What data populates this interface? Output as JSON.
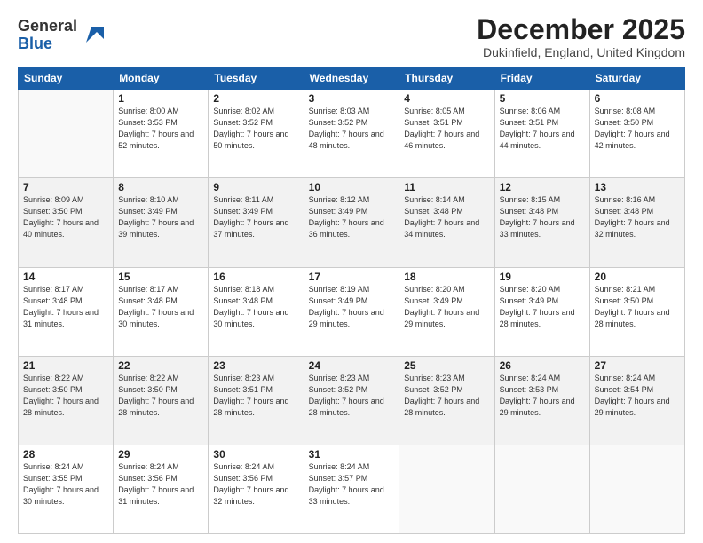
{
  "header": {
    "logo": {
      "line1": "General",
      "line2": "Blue"
    },
    "title": "December 2025",
    "subtitle": "Dukinfield, England, United Kingdom"
  },
  "weekdays": [
    "Sunday",
    "Monday",
    "Tuesday",
    "Wednesday",
    "Thursday",
    "Friday",
    "Saturday"
  ],
  "weeks": [
    [
      {
        "day": "",
        "sunrise": "",
        "sunset": "",
        "daylight": ""
      },
      {
        "day": "1",
        "sunrise": "8:00 AM",
        "sunset": "3:53 PM",
        "daylight": "7 hours and 52 minutes."
      },
      {
        "day": "2",
        "sunrise": "8:02 AM",
        "sunset": "3:52 PM",
        "daylight": "7 hours and 50 minutes."
      },
      {
        "day": "3",
        "sunrise": "8:03 AM",
        "sunset": "3:52 PM",
        "daylight": "7 hours and 48 minutes."
      },
      {
        "day": "4",
        "sunrise": "8:05 AM",
        "sunset": "3:51 PM",
        "daylight": "7 hours and 46 minutes."
      },
      {
        "day": "5",
        "sunrise": "8:06 AM",
        "sunset": "3:51 PM",
        "daylight": "7 hours and 44 minutes."
      },
      {
        "day": "6",
        "sunrise": "8:08 AM",
        "sunset": "3:50 PM",
        "daylight": "7 hours and 42 minutes."
      }
    ],
    [
      {
        "day": "7",
        "sunrise": "8:09 AM",
        "sunset": "3:50 PM",
        "daylight": "7 hours and 40 minutes."
      },
      {
        "day": "8",
        "sunrise": "8:10 AM",
        "sunset": "3:49 PM",
        "daylight": "7 hours and 39 minutes."
      },
      {
        "day": "9",
        "sunrise": "8:11 AM",
        "sunset": "3:49 PM",
        "daylight": "7 hours and 37 minutes."
      },
      {
        "day": "10",
        "sunrise": "8:12 AM",
        "sunset": "3:49 PM",
        "daylight": "7 hours and 36 minutes."
      },
      {
        "day": "11",
        "sunrise": "8:14 AM",
        "sunset": "3:48 PM",
        "daylight": "7 hours and 34 minutes."
      },
      {
        "day": "12",
        "sunrise": "8:15 AM",
        "sunset": "3:48 PM",
        "daylight": "7 hours and 33 minutes."
      },
      {
        "day": "13",
        "sunrise": "8:16 AM",
        "sunset": "3:48 PM",
        "daylight": "7 hours and 32 minutes."
      }
    ],
    [
      {
        "day": "14",
        "sunrise": "8:17 AM",
        "sunset": "3:48 PM",
        "daylight": "7 hours and 31 minutes."
      },
      {
        "day": "15",
        "sunrise": "8:17 AM",
        "sunset": "3:48 PM",
        "daylight": "7 hours and 30 minutes."
      },
      {
        "day": "16",
        "sunrise": "8:18 AM",
        "sunset": "3:48 PM",
        "daylight": "7 hours and 30 minutes."
      },
      {
        "day": "17",
        "sunrise": "8:19 AM",
        "sunset": "3:49 PM",
        "daylight": "7 hours and 29 minutes."
      },
      {
        "day": "18",
        "sunrise": "8:20 AM",
        "sunset": "3:49 PM",
        "daylight": "7 hours and 29 minutes."
      },
      {
        "day": "19",
        "sunrise": "8:20 AM",
        "sunset": "3:49 PM",
        "daylight": "7 hours and 28 minutes."
      },
      {
        "day": "20",
        "sunrise": "8:21 AM",
        "sunset": "3:50 PM",
        "daylight": "7 hours and 28 minutes."
      }
    ],
    [
      {
        "day": "21",
        "sunrise": "8:22 AM",
        "sunset": "3:50 PM",
        "daylight": "7 hours and 28 minutes."
      },
      {
        "day": "22",
        "sunrise": "8:22 AM",
        "sunset": "3:50 PM",
        "daylight": "7 hours and 28 minutes."
      },
      {
        "day": "23",
        "sunrise": "8:23 AM",
        "sunset": "3:51 PM",
        "daylight": "7 hours and 28 minutes."
      },
      {
        "day": "24",
        "sunrise": "8:23 AM",
        "sunset": "3:52 PM",
        "daylight": "7 hours and 28 minutes."
      },
      {
        "day": "25",
        "sunrise": "8:23 AM",
        "sunset": "3:52 PM",
        "daylight": "7 hours and 28 minutes."
      },
      {
        "day": "26",
        "sunrise": "8:24 AM",
        "sunset": "3:53 PM",
        "daylight": "7 hours and 29 minutes."
      },
      {
        "day": "27",
        "sunrise": "8:24 AM",
        "sunset": "3:54 PM",
        "daylight": "7 hours and 29 minutes."
      }
    ],
    [
      {
        "day": "28",
        "sunrise": "8:24 AM",
        "sunset": "3:55 PM",
        "daylight": "7 hours and 30 minutes."
      },
      {
        "day": "29",
        "sunrise": "8:24 AM",
        "sunset": "3:56 PM",
        "daylight": "7 hours and 31 minutes."
      },
      {
        "day": "30",
        "sunrise": "8:24 AM",
        "sunset": "3:56 PM",
        "daylight": "7 hours and 32 minutes."
      },
      {
        "day": "31",
        "sunrise": "8:24 AM",
        "sunset": "3:57 PM",
        "daylight": "7 hours and 33 minutes."
      },
      {
        "day": "",
        "sunrise": "",
        "sunset": "",
        "daylight": ""
      },
      {
        "day": "",
        "sunrise": "",
        "sunset": "",
        "daylight": ""
      },
      {
        "day": "",
        "sunrise": "",
        "sunset": "",
        "daylight": ""
      }
    ]
  ]
}
